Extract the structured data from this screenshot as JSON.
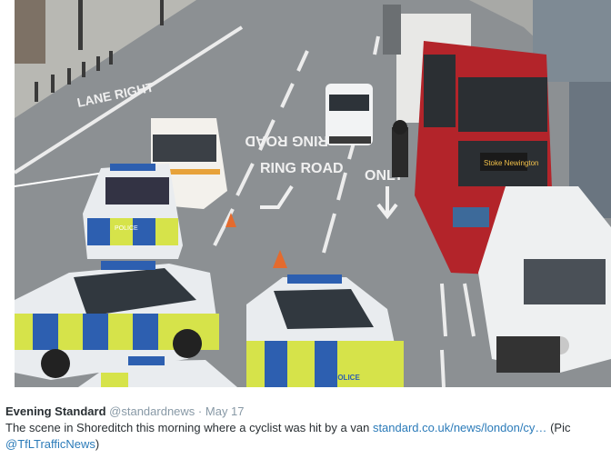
{
  "tweet": {
    "author_name": "Evening Standard",
    "author_handle": "@standardnews",
    "separator": "·",
    "date": "May 17",
    "text": "The scene in Shoreditch this morning where a cyclist was hit by a van",
    "link": "standard.co.uk/news/london/cy…",
    "trailing_text": "(Pic",
    "mention": "@TfLTrafficNews",
    "closing": ")"
  },
  "photo": {
    "road_markings": [
      "LANE RIGHT",
      "RING ROAD",
      "RING ROAD",
      "ONLY"
    ],
    "bus_destination": "Stoke Newington",
    "police_labels": [
      "POLICE",
      "POLICE",
      "POLICE"
    ],
    "colors": {
      "road": "#8f9396",
      "pavement": "#b9b9b5",
      "police_yellow": "#d6e34a",
      "police_blue": "#2d5fb0",
      "bus_red": "#b3242a",
      "van_white": "#eef0f1"
    }
  }
}
